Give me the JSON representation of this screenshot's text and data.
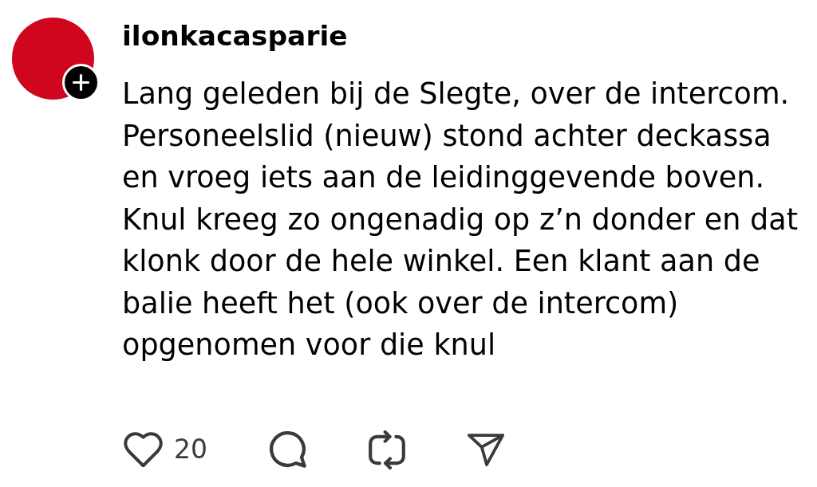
{
  "post": {
    "username": "ilonkacasparie",
    "text": "Lang geleden bij de Slegte, over de intercom. Personeelslid (nieuw) stond achter deckassa en vroeg iets aan de leidinggevende boven. Knul kreeg zo ongenadig op z’n donder en dat klonk door de hele winkel. Een klant aan de balie heeft het (ook over de intercom) opgenomen voor die knul",
    "actions": [
      {
        "kind": "like",
        "count": "20"
      },
      {
        "kind": "reply"
      },
      {
        "kind": "repost"
      },
      {
        "kind": "share"
      }
    ]
  }
}
